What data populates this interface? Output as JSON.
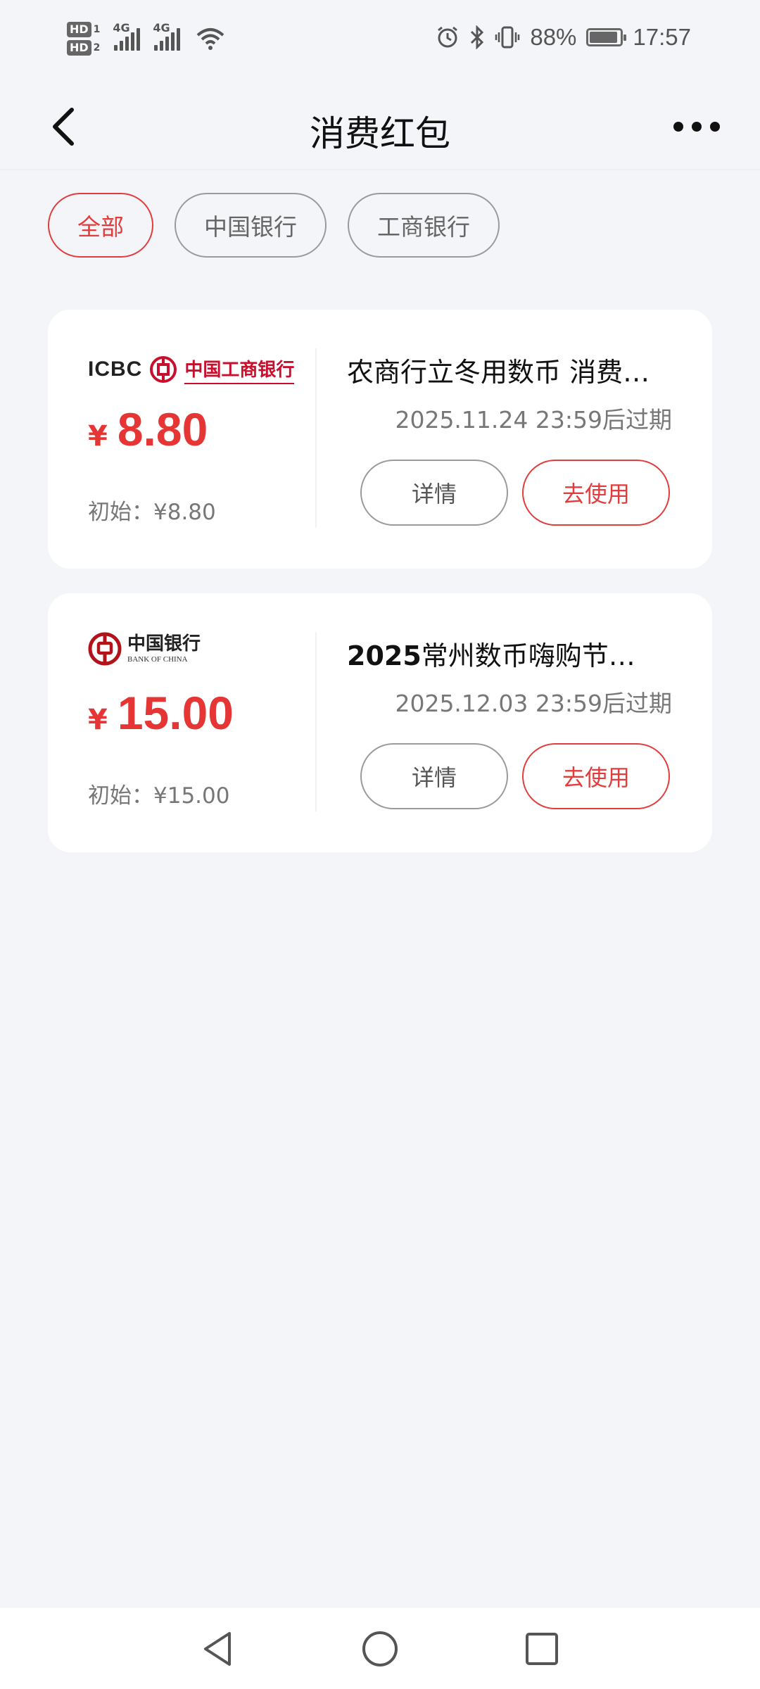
{
  "status_bar": {
    "hd1": "HD",
    "hd1_index": "1",
    "hd2": "HD",
    "hd2_index": "2",
    "network1": "4G",
    "network2": "4G",
    "battery_percent": "88%",
    "time": "17:57"
  },
  "header": {
    "title": "消费红包"
  },
  "filters": [
    {
      "label": "全部",
      "active": true
    },
    {
      "label": "中国银行",
      "active": false
    },
    {
      "label": "工商银行",
      "active": false
    }
  ],
  "vouchers": [
    {
      "bank_logo_text": "ICBC",
      "bank_name": "中国工商银行",
      "currency": "¥",
      "amount": "8.80",
      "initial": "初始：¥8.80",
      "title": "农商行立冬用数币 消费红包",
      "expire": "2025.11.24 23:59后过期",
      "detail_label": "详情",
      "use_label": "去使用"
    },
    {
      "bank_logo_text": "中国银行",
      "bank_name_en": "BANK OF CHINA",
      "currency": "¥",
      "amount": "15.00",
      "initial": "初始：¥15.00",
      "title_bold_part": "2025",
      "title_rest": "常州数币嗨购节（消费红包）",
      "expire": "2025.12.03 23:59后过期",
      "detail_label": "详情",
      "use_label": "去使用"
    }
  ],
  "colors": {
    "accent": "#e23c3c",
    "amount": "#e53535",
    "background": "#f4f5f9"
  }
}
